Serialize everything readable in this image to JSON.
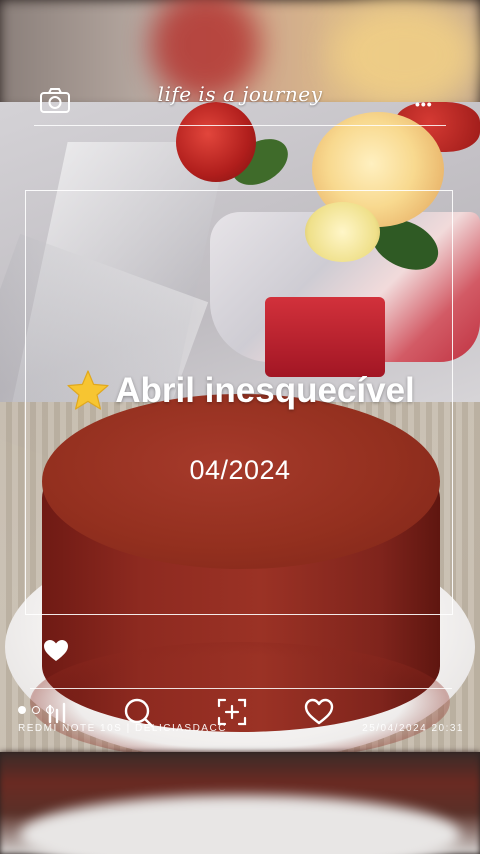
{
  "header": {
    "title": "life is a journey",
    "camera_icon": "camera-icon",
    "more_icon": "more-icon",
    "more_label": "•••"
  },
  "album": {
    "title": "Abril inesquecível",
    "title_icon": "star-icon",
    "date": "04/2024"
  },
  "actions": {
    "like_icon": "heart-icon",
    "bar_icon": "bar-chart-icon",
    "search_icon": "search-icon",
    "scan_icon": "scan-add-icon",
    "favorite_icon": "heart-outline-icon"
  },
  "footer": {
    "left_text": "REDMI NOTE 10S | DELICIASDACC",
    "right_text": "25/04/2024 20:31"
  },
  "colors": {
    "overlay_text": "#ffffff",
    "star": "#f7c531",
    "cake": "#8e2a20"
  }
}
